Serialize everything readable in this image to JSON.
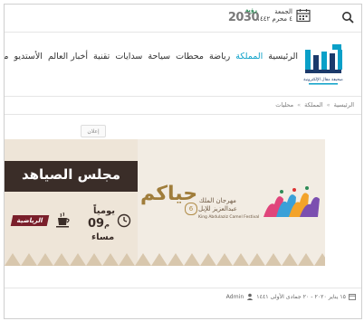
{
  "topbar": {
    "date_line1": "الجمعة",
    "date_line2": "٤ محرم ١٤٤٢",
    "vision_logo": "2030",
    "vision_small": "رؤية"
  },
  "header": {
    "logo_caption": "صحيفة مقال الإلكترونية",
    "nav": [
      {
        "label": "الرئيسية",
        "active": false
      },
      {
        "label": "المملكة",
        "active": true
      },
      {
        "label": "رياضة",
        "active": false
      },
      {
        "label": "محطات",
        "active": false
      },
      {
        "label": "سياحة",
        "active": false
      },
      {
        "label": "سدايات",
        "active": false
      },
      {
        "label": "تقنية",
        "active": false
      },
      {
        "label": "أخبار العالم",
        "active": false
      },
      {
        "label": "الأستديو",
        "active": false
      },
      {
        "label": "مق",
        "active": false
      }
    ]
  },
  "breadcrumb": {
    "items": [
      "الرئيسية",
      "المملكة",
      "محليات"
    ],
    "separator": "»"
  },
  "ad": {
    "tag": "إعلان",
    "title": "مجلس الصياهد",
    "days": "يومياً",
    "time": "09",
    "time_unit": "م",
    "evening": "مساء",
    "sports_badge": "الرياضية",
    "calligraphy": "حياكم",
    "festival_number": "6",
    "festival_line1": "مهرجان الملك",
    "festival_line2": "عبدالعزيز للإبل",
    "festival_en": "King Abdulaziz Camel Festival"
  },
  "meta": {
    "date": "١٥ يناير ٢٠٢٠ - ٢٠ جمادى الأولى ١٤٤١",
    "author": "Admin"
  },
  "colors": {
    "accent": "#0aa0c8",
    "ad_dark": "#3a2d28",
    "ad_bg": "#f2ece3",
    "sports": "#7a1f2b"
  }
}
